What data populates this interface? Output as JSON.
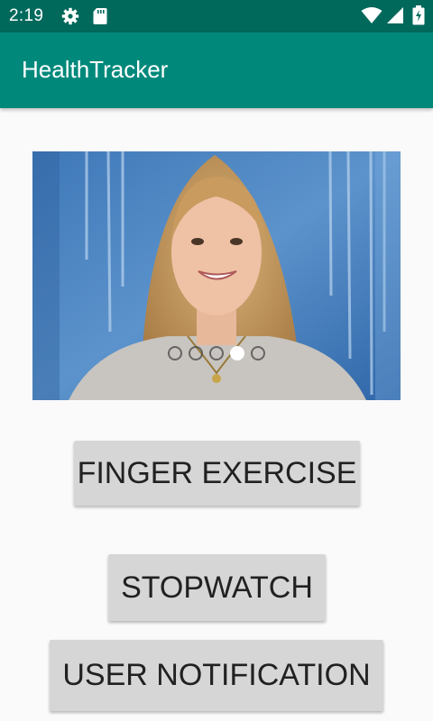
{
  "status_bar": {
    "time": "2:19",
    "icons": [
      "gear-icon",
      "sd-card-icon",
      "wifi-icon",
      "signal-icon",
      "battery-icon"
    ]
  },
  "app_bar": {
    "title": "HealthTracker",
    "color": "#00897b",
    "status_color": "#00695c"
  },
  "carousel": {
    "image": "portrait photo of a smiling woman with long blonde hair in front of a blue painted wall",
    "slide_count": 5,
    "active_index": 3
  },
  "buttons": {
    "finger_exercise": "FINGER EXERCISE",
    "stopwatch": "STOPWATCH",
    "user_notification": "USER NOTIFICATION"
  }
}
